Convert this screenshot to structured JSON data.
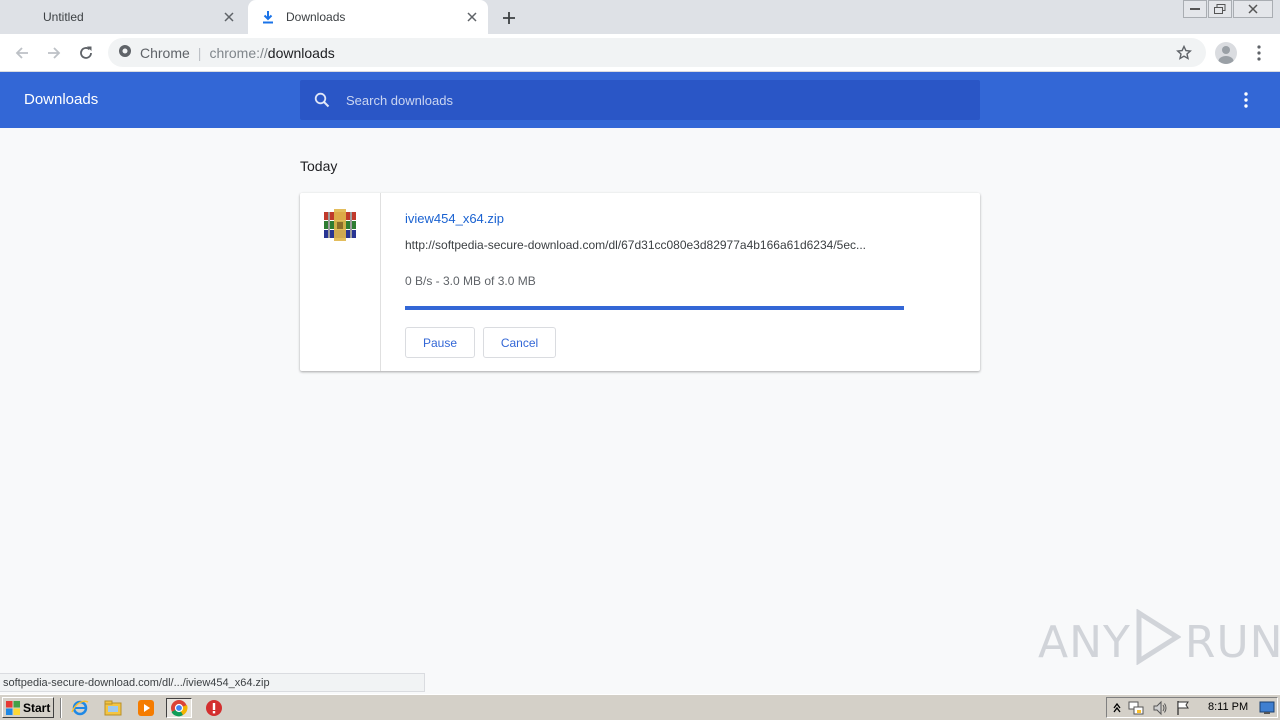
{
  "tabs": [
    {
      "title": "Untitled",
      "active": false
    },
    {
      "title": "Downloads",
      "active": true
    }
  ],
  "omnibox": {
    "site_label": "Chrome",
    "url_scheme": "chrome://",
    "url_host": "downloads"
  },
  "downloads_page": {
    "title": "Downloads",
    "search_placeholder": "Search downloads",
    "section_date": "Today",
    "item": {
      "file_name": "iview454_x64.zip",
      "url": "http://softpedia-secure-download.com/dl/67d31cc080e3d82977a4b166a61d6234/5ec...",
      "status": "0 B/s - 3.0 MB of 3.0 MB",
      "progress_fraction": 1.0,
      "pause_label": "Pause",
      "cancel_label": "Cancel"
    }
  },
  "status_bubble": "softpedia-secure-download.com/dl/.../iview454_x64.zip",
  "watermark": {
    "left": "ANY",
    "right": "RUN"
  },
  "taskbar": {
    "start_label": "Start",
    "apps": [
      "internet-explorer-icon",
      "explorer-icon",
      "media-player-icon",
      "chrome-icon",
      "stop-icon"
    ],
    "clock": "8:11 PM"
  },
  "colors": {
    "header_blue": "#3367d6",
    "search_blue": "#2a56c6",
    "link_blue": "#1a62d1",
    "page_bg": "#f8f9fa"
  }
}
